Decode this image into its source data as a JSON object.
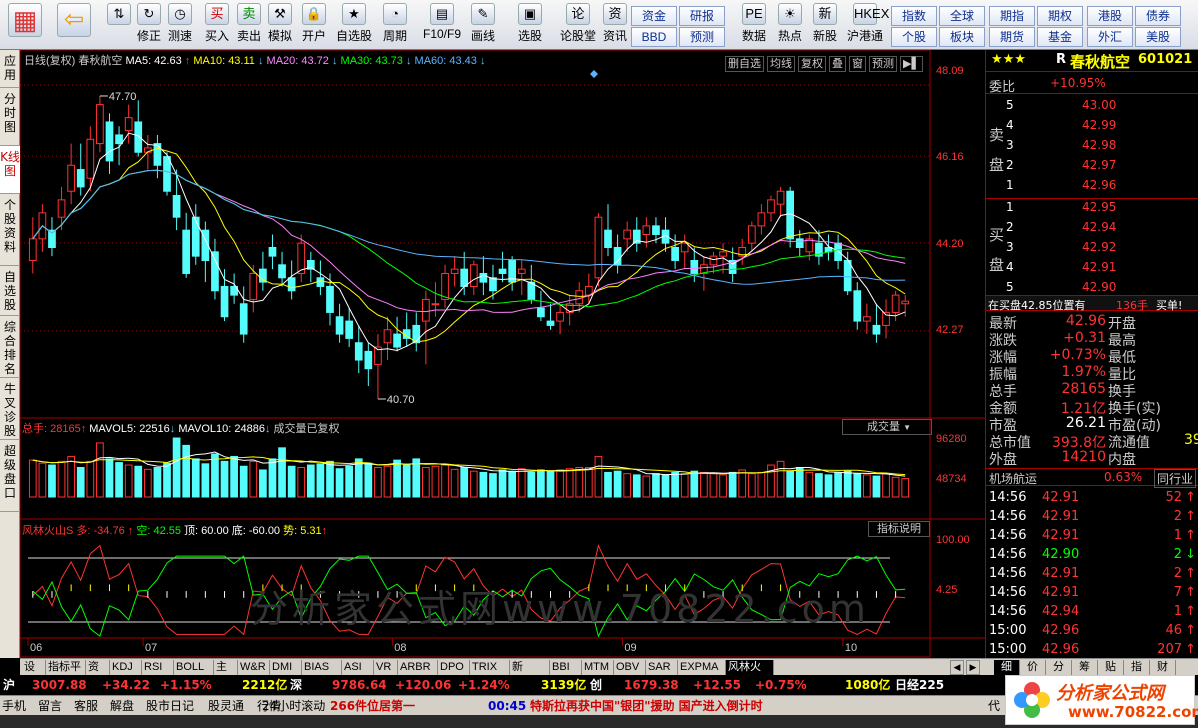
{
  "toolbar": {
    "buttons": [
      {
        "label": "",
        "icon": "app-menu-icon"
      },
      {
        "label": "",
        "icon": "back-arrow-icon"
      },
      {
        "label": "",
        "icon": "up-down-arrow-icon"
      },
      {
        "label": "修正",
        "icon": "repair-icon"
      },
      {
        "label": "测速",
        "icon": "speed-icon"
      },
      {
        "label": "买入",
        "icon": "buy-icon"
      },
      {
        "label": "卖出",
        "icon": "sell-icon"
      },
      {
        "label": "模拟",
        "icon": "simulate-icon"
      },
      {
        "label": "开户",
        "icon": "account-icon"
      },
      {
        "label": "自选股",
        "icon": "star-icon"
      },
      {
        "label": "周期",
        "icon": "period-icon"
      },
      {
        "label": "F10/F9",
        "icon": "f10-icon"
      },
      {
        "label": "画线",
        "icon": "draw-icon"
      },
      {
        "label": "选股",
        "icon": "select-stock-icon"
      },
      {
        "label": "论股堂",
        "icon": "forum-icon"
      },
      {
        "label": "资讯",
        "icon": "news-icon"
      },
      {
        "label": "数据",
        "icon": "data-icon"
      },
      {
        "label": "热点",
        "icon": "hot-icon"
      },
      {
        "label": "新股",
        "icon": "new-stock-icon"
      },
      {
        "label": "沪港通",
        "icon": "hk-connect-icon"
      }
    ],
    "market_buttons": [
      "资金",
      "研报",
      "BBD",
      "预测",
      "指数",
      "全球",
      "期指",
      "期权",
      "港股",
      "债券",
      "个股",
      "板块",
      "期货",
      "基金",
      "外汇",
      "美股"
    ],
    "buy_char": "买",
    "sell_char": "卖",
    "zi_char": "资",
    "lun_char": "论",
    "pe_char": "PE",
    "new_char": "新",
    "hkex_char": "HKEX"
  },
  "sidebar": [
    "应用",
    "分时图",
    "K线图",
    "个股资料",
    "自选股",
    "综合排名",
    "牛叉诊股",
    "超级盘口"
  ],
  "chart": {
    "kline_info": {
      "label": "日线(复权)",
      "name": "春秋航空",
      "ma5": "MA5: 42.63",
      "ma10": "MA10: 43.11",
      "ma20": "MA20: 43.72",
      "ma30": "MA30: 43.73",
      "ma60": "MA60: 43.43"
    },
    "kline_buttons": [
      "删自选",
      "均线",
      "复权",
      "叠",
      "窗",
      "预测"
    ],
    "price_axis": [
      "48.09",
      "46.16",
      "44.20",
      "42.27"
    ],
    "high_label": "47.70",
    "low_label": "40.70",
    "vol_info": {
      "total": "总手: 28165",
      "mavol5": "MAVOL5: 22516",
      "mavol10": "MAVOL10: 24886",
      "note": "成交量已复权"
    },
    "vol_button": "成交量",
    "vol_axis": [
      "96280",
      "48734"
    ],
    "ind_info": {
      "name": "风林火山S",
      "duo": "多: -34.76",
      "kong": "空: 42.55",
      "top": "顶: 60.00",
      "bottom": "底: -60.00",
      "shi": "势: 5.31"
    },
    "ind_button": "指标说明",
    "ind_axis": [
      "100.00",
      "4.25"
    ],
    "months": [
      "06",
      "07",
      "08",
      "09",
      "10"
    ],
    "watermark": "分析家公式网www.70822.com"
  },
  "chart_data": {
    "type": "candlestick",
    "ohlc": [
      [
        43.9,
        44.9,
        43.6,
        44.4
      ],
      [
        44.4,
        45.2,
        44.1,
        45.0
      ],
      [
        44.6,
        44.9,
        44.0,
        44.2
      ],
      [
        44.9,
        45.6,
        44.6,
        45.3
      ],
      [
        45.5,
        46.6,
        45.2,
        46.1
      ],
      [
        46.0,
        46.6,
        45.4,
        45.6
      ],
      [
        45.8,
        47.0,
        45.5,
        46.7
      ],
      [
        46.6,
        47.7,
        46.4,
        47.5
      ],
      [
        47.1,
        47.3,
        45.9,
        46.2
      ],
      [
        46.8,
        47.0,
        46.1,
        46.6
      ],
      [
        46.9,
        47.5,
        46.6,
        47.2
      ],
      [
        47.1,
        47.6,
        46.3,
        46.4
      ],
      [
        46.4,
        46.8,
        46.0,
        46.5
      ],
      [
        46.6,
        46.8,
        45.8,
        46.1
      ],
      [
        46.3,
        46.4,
        45.4,
        45.5
      ],
      [
        45.4,
        46.0,
        44.6,
        44.9
      ],
      [
        44.6,
        45.0,
        43.5,
        43.6
      ],
      [
        44.9,
        45.2,
        43.8,
        44.0
      ],
      [
        44.6,
        44.8,
        43.4,
        43.9
      ],
      [
        44.1,
        44.4,
        43.0,
        43.2
      ],
      [
        43.3,
        43.7,
        42.5,
        42.6
      ],
      [
        43.3,
        43.6,
        42.9,
        43.1
      ],
      [
        42.9,
        43.3,
        42.0,
        42.2
      ],
      [
        43.0,
        43.8,
        42.7,
        43.6
      ],
      [
        43.7,
        44.1,
        43.2,
        43.4
      ],
      [
        44.2,
        44.5,
        43.7,
        44.0
      ],
      [
        43.8,
        44.1,
        43.3,
        43.5
      ],
      [
        43.5,
        43.9,
        43.0,
        43.2
      ],
      [
        43.6,
        44.5,
        43.4,
        44.3
      ],
      [
        43.9,
        44.1,
        43.4,
        43.7
      ],
      [
        43.5,
        43.9,
        43.1,
        43.3
      ],
      [
        43.3,
        43.6,
        42.4,
        42.7
      ],
      [
        42.6,
        42.9,
        42.0,
        42.2
      ],
      [
        42.5,
        42.8,
        41.9,
        42.1
      ],
      [
        42.0,
        42.4,
        41.3,
        41.6
      ],
      [
        41.8,
        42.0,
        41.0,
        41.4
      ],
      [
        41.5,
        42.2,
        40.7,
        41.9
      ],
      [
        42.0,
        42.6,
        41.6,
        42.3
      ],
      [
        42.2,
        42.6,
        41.8,
        41.9
      ],
      [
        42.3,
        42.7,
        41.9,
        42.1
      ],
      [
        42.4,
        42.7,
        41.8,
        42.0
      ],
      [
        42.5,
        43.2,
        41.5,
        43.0
      ],
      [
        42.9,
        43.4,
        42.6,
        42.9
      ],
      [
        43.0,
        43.8,
        42.8,
        43.6
      ],
      [
        43.6,
        44.0,
        43.3,
        43.7
      ],
      [
        43.7,
        44.1,
        43.1,
        43.3
      ],
      [
        43.3,
        43.9,
        43.1,
        43.8
      ],
      [
        43.6,
        44.0,
        43.1,
        43.4
      ],
      [
        43.5,
        43.8,
        43.0,
        43.2
      ],
      [
        43.7,
        44.1,
        43.4,
        43.6
      ],
      [
        43.9,
        44.0,
        43.2,
        43.4
      ],
      [
        43.6,
        43.9,
        43.1,
        43.7
      ],
      [
        43.4,
        43.8,
        42.9,
        43.0
      ],
      [
        42.8,
        43.2,
        42.5,
        42.6
      ],
      [
        42.5,
        42.9,
        42.3,
        42.4
      ],
      [
        42.5,
        42.9,
        42.2,
        42.7
      ],
      [
        42.7,
        43.1,
        42.4,
        42.9
      ],
      [
        42.9,
        43.4,
        42.7,
        43.2
      ],
      [
        43.1,
        43.6,
        42.9,
        43.3
      ],
      [
        43.5,
        45.0,
        43.3,
        44.9
      ],
      [
        44.6,
        45.2,
        44.0,
        44.2
      ],
      [
        44.2,
        44.5,
        43.6,
        43.8
      ],
      [
        44.4,
        44.8,
        44.1,
        44.6
      ],
      [
        44.6,
        44.9,
        44.1,
        44.3
      ],
      [
        44.5,
        44.9,
        44.2,
        44.7
      ],
      [
        44.7,
        44.9,
        44.3,
        44.5
      ],
      [
        44.6,
        44.9,
        44.1,
        44.3
      ],
      [
        44.2,
        44.5,
        43.7,
        43.9
      ],
      [
        44.1,
        44.5,
        43.7,
        44.3
      ],
      [
        43.9,
        44.2,
        43.4,
        43.6
      ],
      [
        43.6,
        44.0,
        43.2,
        43.8
      ],
      [
        43.8,
        44.1,
        43.6,
        44.0
      ],
      [
        44.0,
        44.3,
        43.6,
        44.1
      ],
      [
        43.9,
        44.2,
        43.4,
        43.6
      ],
      [
        44.0,
        44.4,
        43.8,
        44.2
      ],
      [
        44.3,
        44.8,
        44.1,
        44.7
      ],
      [
        44.7,
        45.2,
        44.5,
        45.0
      ],
      [
        45.0,
        45.4,
        44.8,
        45.3
      ],
      [
        45.2,
        45.6,
        44.9,
        45.5
      ],
      [
        45.5,
        45.6,
        44.2,
        44.4
      ],
      [
        44.4,
        44.6,
        44.0,
        44.2
      ],
      [
        44.1,
        44.5,
        43.9,
        44.4
      ],
      [
        44.3,
        44.6,
        43.8,
        44.0
      ],
      [
        44.2,
        44.5,
        43.9,
        44.1
      ],
      [
        44.3,
        44.5,
        43.7,
        43.9
      ],
      [
        43.9,
        44.1,
        43.1,
        43.2
      ],
      [
        43.2,
        43.4,
        42.3,
        42.5
      ],
      [
        42.5,
        42.9,
        42.2,
        42.6
      ],
      [
        42.4,
        42.9,
        42.0,
        42.2
      ],
      [
        42.4,
        43.0,
        42.1,
        42.7
      ],
      [
        42.7,
        43.2,
        42.5,
        43.1
      ],
      [
        42.9,
        43.1,
        42.6,
        42.96
      ]
    ],
    "volume": [
      60,
      55,
      52,
      58,
      66,
      48,
      58,
      88,
      62,
      56,
      52,
      50,
      45,
      48,
      55,
      96,
      84,
      62,
      54,
      70,
      58,
      66,
      50,
      58,
      44,
      62,
      80,
      50,
      48,
      52,
      54,
      58,
      46,
      50,
      62,
      55,
      48,
      50,
      60,
      52,
      62,
      48,
      50,
      52,
      45,
      48,
      42,
      40,
      38,
      44,
      42,
      46,
      40,
      44,
      42,
      44,
      46,
      48,
      48,
      66,
      40,
      42,
      38,
      36,
      34,
      38,
      36,
      40,
      38,
      42,
      40,
      38,
      36,
      40,
      44,
      38,
      40,
      52,
      58,
      42,
      48,
      40,
      38,
      36,
      40,
      42,
      38,
      36,
      34,
      38,
      32,
      30
    ],
    "price_ylim": [
      40.4,
      48.3
    ],
    "months_at_bar": [
      0,
      12,
      38,
      62,
      85
    ],
    "ind_ylim": [
      -80,
      100
    ]
  },
  "right_panel": {
    "stars": "★★★",
    "code_prefix": "R",
    "name": "春秋航空",
    "code": "601021",
    "weibi_label": "委比",
    "weibi_value": "+10.95%",
    "sell_label": "卖盘",
    "buy_label": "买盘",
    "sell": [
      [
        "5",
        "43.00"
      ],
      [
        "4",
        "42.99"
      ],
      [
        "3",
        "42.98"
      ],
      [
        "2",
        "42.97"
      ],
      [
        "1",
        "42.96"
      ]
    ],
    "buy": [
      [
        "1",
        "42.95"
      ],
      [
        "2",
        "42.94"
      ],
      [
        "3",
        "42.92"
      ],
      [
        "4",
        "42.91"
      ],
      [
        "5",
        "42.90"
      ]
    ],
    "position_text": "在买盘42.85位置有",
    "position_vol": "136手",
    "position_btn": "买单!",
    "quotes": [
      [
        "最新",
        "42.96",
        "开盘",
        ""
      ],
      [
        "涨跌",
        "+0.31",
        "最高",
        ""
      ],
      [
        "涨幅",
        "+0.73%",
        "最低",
        ""
      ],
      [
        "振幅",
        "1.97%",
        "量比",
        ""
      ],
      [
        "总手",
        "28165",
        "换手",
        ""
      ],
      [
        "金额",
        "1.21亿",
        "换手(实)",
        ""
      ],
      [
        "市盈",
        "26.21",
        "市盈(动)",
        ""
      ],
      [
        "总市值",
        "393.8亿",
        "流通值",
        "39"
      ],
      [
        "外盘",
        "14210",
        "内盘",
        ""
      ]
    ],
    "sector_name": "机场航运",
    "sector_change": "0.63%",
    "sector_btn": "同行业",
    "trades": [
      [
        "14:56",
        "42.91",
        "52",
        "up"
      ],
      [
        "14:56",
        "42.91",
        "2",
        "up"
      ],
      [
        "14:56",
        "42.91",
        "1",
        "up"
      ],
      [
        "14:56",
        "42.90",
        "2",
        "down"
      ],
      [
        "14:56",
        "42.91",
        "2",
        "up"
      ],
      [
        "14:56",
        "42.91",
        "7",
        "up"
      ],
      [
        "14:56",
        "42.94",
        "1",
        "up"
      ],
      [
        "15:00",
        "42.96",
        "46",
        "up"
      ],
      [
        "15:00",
        "42.96",
        "207",
        "up"
      ]
    ],
    "tabs": [
      "细",
      "价",
      "分",
      "筹",
      "贴",
      "指",
      "财"
    ]
  },
  "bottom_tabs": [
    "设置",
    "指标平台",
    "资讯",
    "KDJ",
    "RSI",
    "BOLL",
    "主力",
    "W&R",
    "DMI",
    "BIAS",
    "ASI",
    "VR",
    "ARBR",
    "DPO",
    "TRIX",
    "新DMA",
    "BBI",
    "MTM",
    "OBV",
    "SAR",
    "EXPMA",
    "风林火山S"
  ],
  "ticker": {
    "sh_label": "沪",
    "sh_val": "3007.88",
    "sh_chg": "+34.22",
    "sh_pct": "+1.15%",
    "sh_amt": "2212亿",
    "sz_label": "深",
    "sz_val": "9786.64",
    "sz_chg": "+120.06",
    "sz_pct": "+1.24%",
    "sz_amt": "3139亿",
    "cy_label": "创",
    "cy_val": "1679.38",
    "cy_chg": "+12.55",
    "cy_pct": "+0.75%",
    "cy_amt": "1080亿",
    "ext": "日经225"
  },
  "status": {
    "items": [
      "手机",
      "留言",
      "客服",
      "解盘",
      "股市日记",
      "股灵通",
      "行情"
    ],
    "scroll_label": "24小时滚动",
    "headline1": "266件位居第一",
    "time": "00:45",
    "headline2": "特斯拉再获中国\"银团\"援助 国产进入倒计时",
    "end": "代"
  },
  "logo": {
    "text": "分析家公式网",
    "url": "www.70822.com"
  },
  "colors": {
    "up": "#ff3232",
    "down": "#54fcfc",
    "ma5": "#ffffff",
    "ma10": "#ffff00",
    "ma20": "#ff80ff",
    "ma30": "#00ff00",
    "ma60": "#5ab4ff",
    "grid": "#a00000"
  }
}
